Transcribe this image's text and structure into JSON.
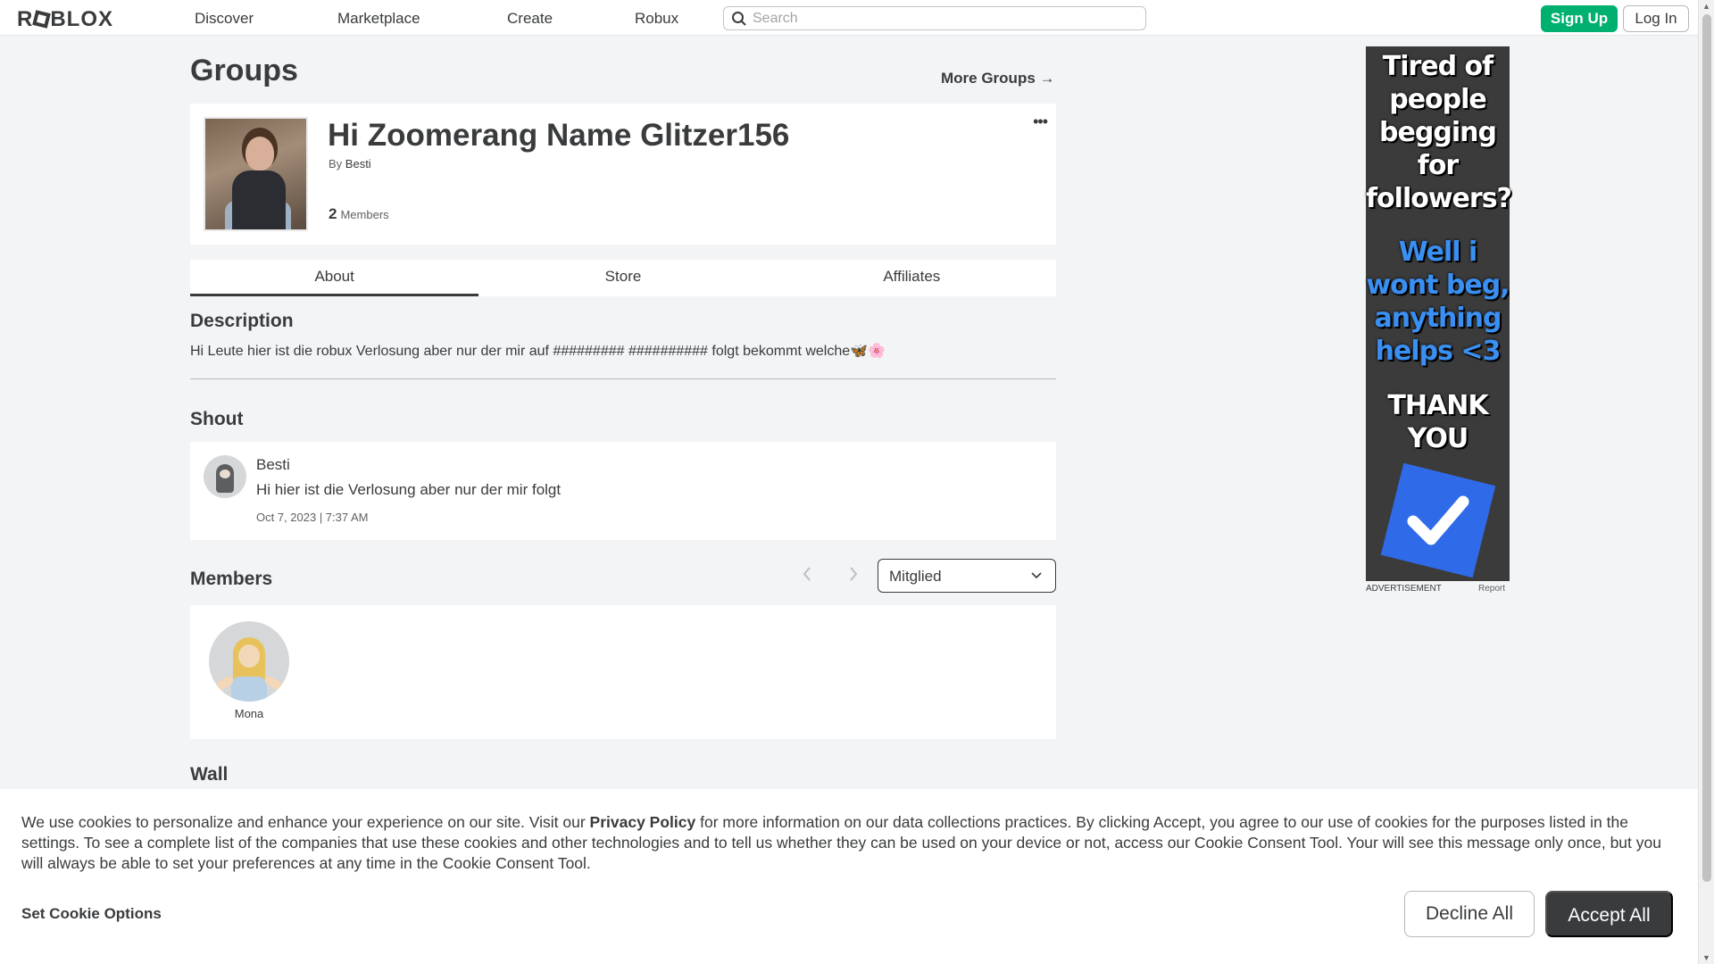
{
  "header": {
    "logo": "ROBLOX",
    "nav": [
      "Discover",
      "Marketplace",
      "Create",
      "Robux"
    ],
    "search_placeholder": "Search",
    "signup_label": "Sign Up",
    "login_label": "Log In"
  },
  "page": {
    "title": "Groups",
    "more_groups": "More Groups →"
  },
  "group": {
    "name": "Hi Zoomerang Name Glitzer156",
    "by_label": "By",
    "owner": "Besti",
    "member_count": "2",
    "members_label": "Members",
    "menu_icon": "more-horizontal-icon"
  },
  "tabs": [
    "About",
    "Store",
    "Affiliates"
  ],
  "active_tab": "About",
  "description": {
    "heading": "Description",
    "text": "Hi Leute hier ist die robux Verlosung aber nur der mir auf ######### ########## folgt bekommt welche🦋🌸"
  },
  "shout": {
    "heading": "Shout",
    "user": "Besti",
    "text": "Hi hier ist die Verlosung aber nur der mir folgt",
    "time": "Oct 7, 2023 | 7:37 AM"
  },
  "members": {
    "heading": "Members",
    "filter_value": "Mitglied",
    "list": [
      {
        "name": "Mona"
      }
    ]
  },
  "wall": {
    "heading": "Wall"
  },
  "ad": {
    "line1": "Tired of people begging for followers?",
    "line2": "Well i wont beg, anything helps <3",
    "line3": "THANK YOU",
    "label": "ADVERTISEMENT",
    "report": "Report"
  },
  "cookie": {
    "text_before": "We use cookies to personalize and enhance your experience on our site. Visit our ",
    "policy_link": "Privacy Policy",
    "text_after": " for more information on our data collections practices. By clicking Accept, you agree to our use of cookies for the purposes listed in the settings. To see a complete list of the companies that use these cookies and other technologies and to tell us whether they can be used on your device or not, access our Cookie Consent Tool. Your will see this message only once, but you will always be able to set your preferences at any time in the Cookie Consent Tool.",
    "options_label": "Set Cookie Options",
    "decline_label": "Decline All",
    "accept_label": "Accept All"
  },
  "colors": {
    "signup_green": "#00b06f",
    "text_primary": "#393b3d",
    "background": "#f2f4f5",
    "ad_blue": "#3a8ff2",
    "accept_button": "#393b3d"
  }
}
